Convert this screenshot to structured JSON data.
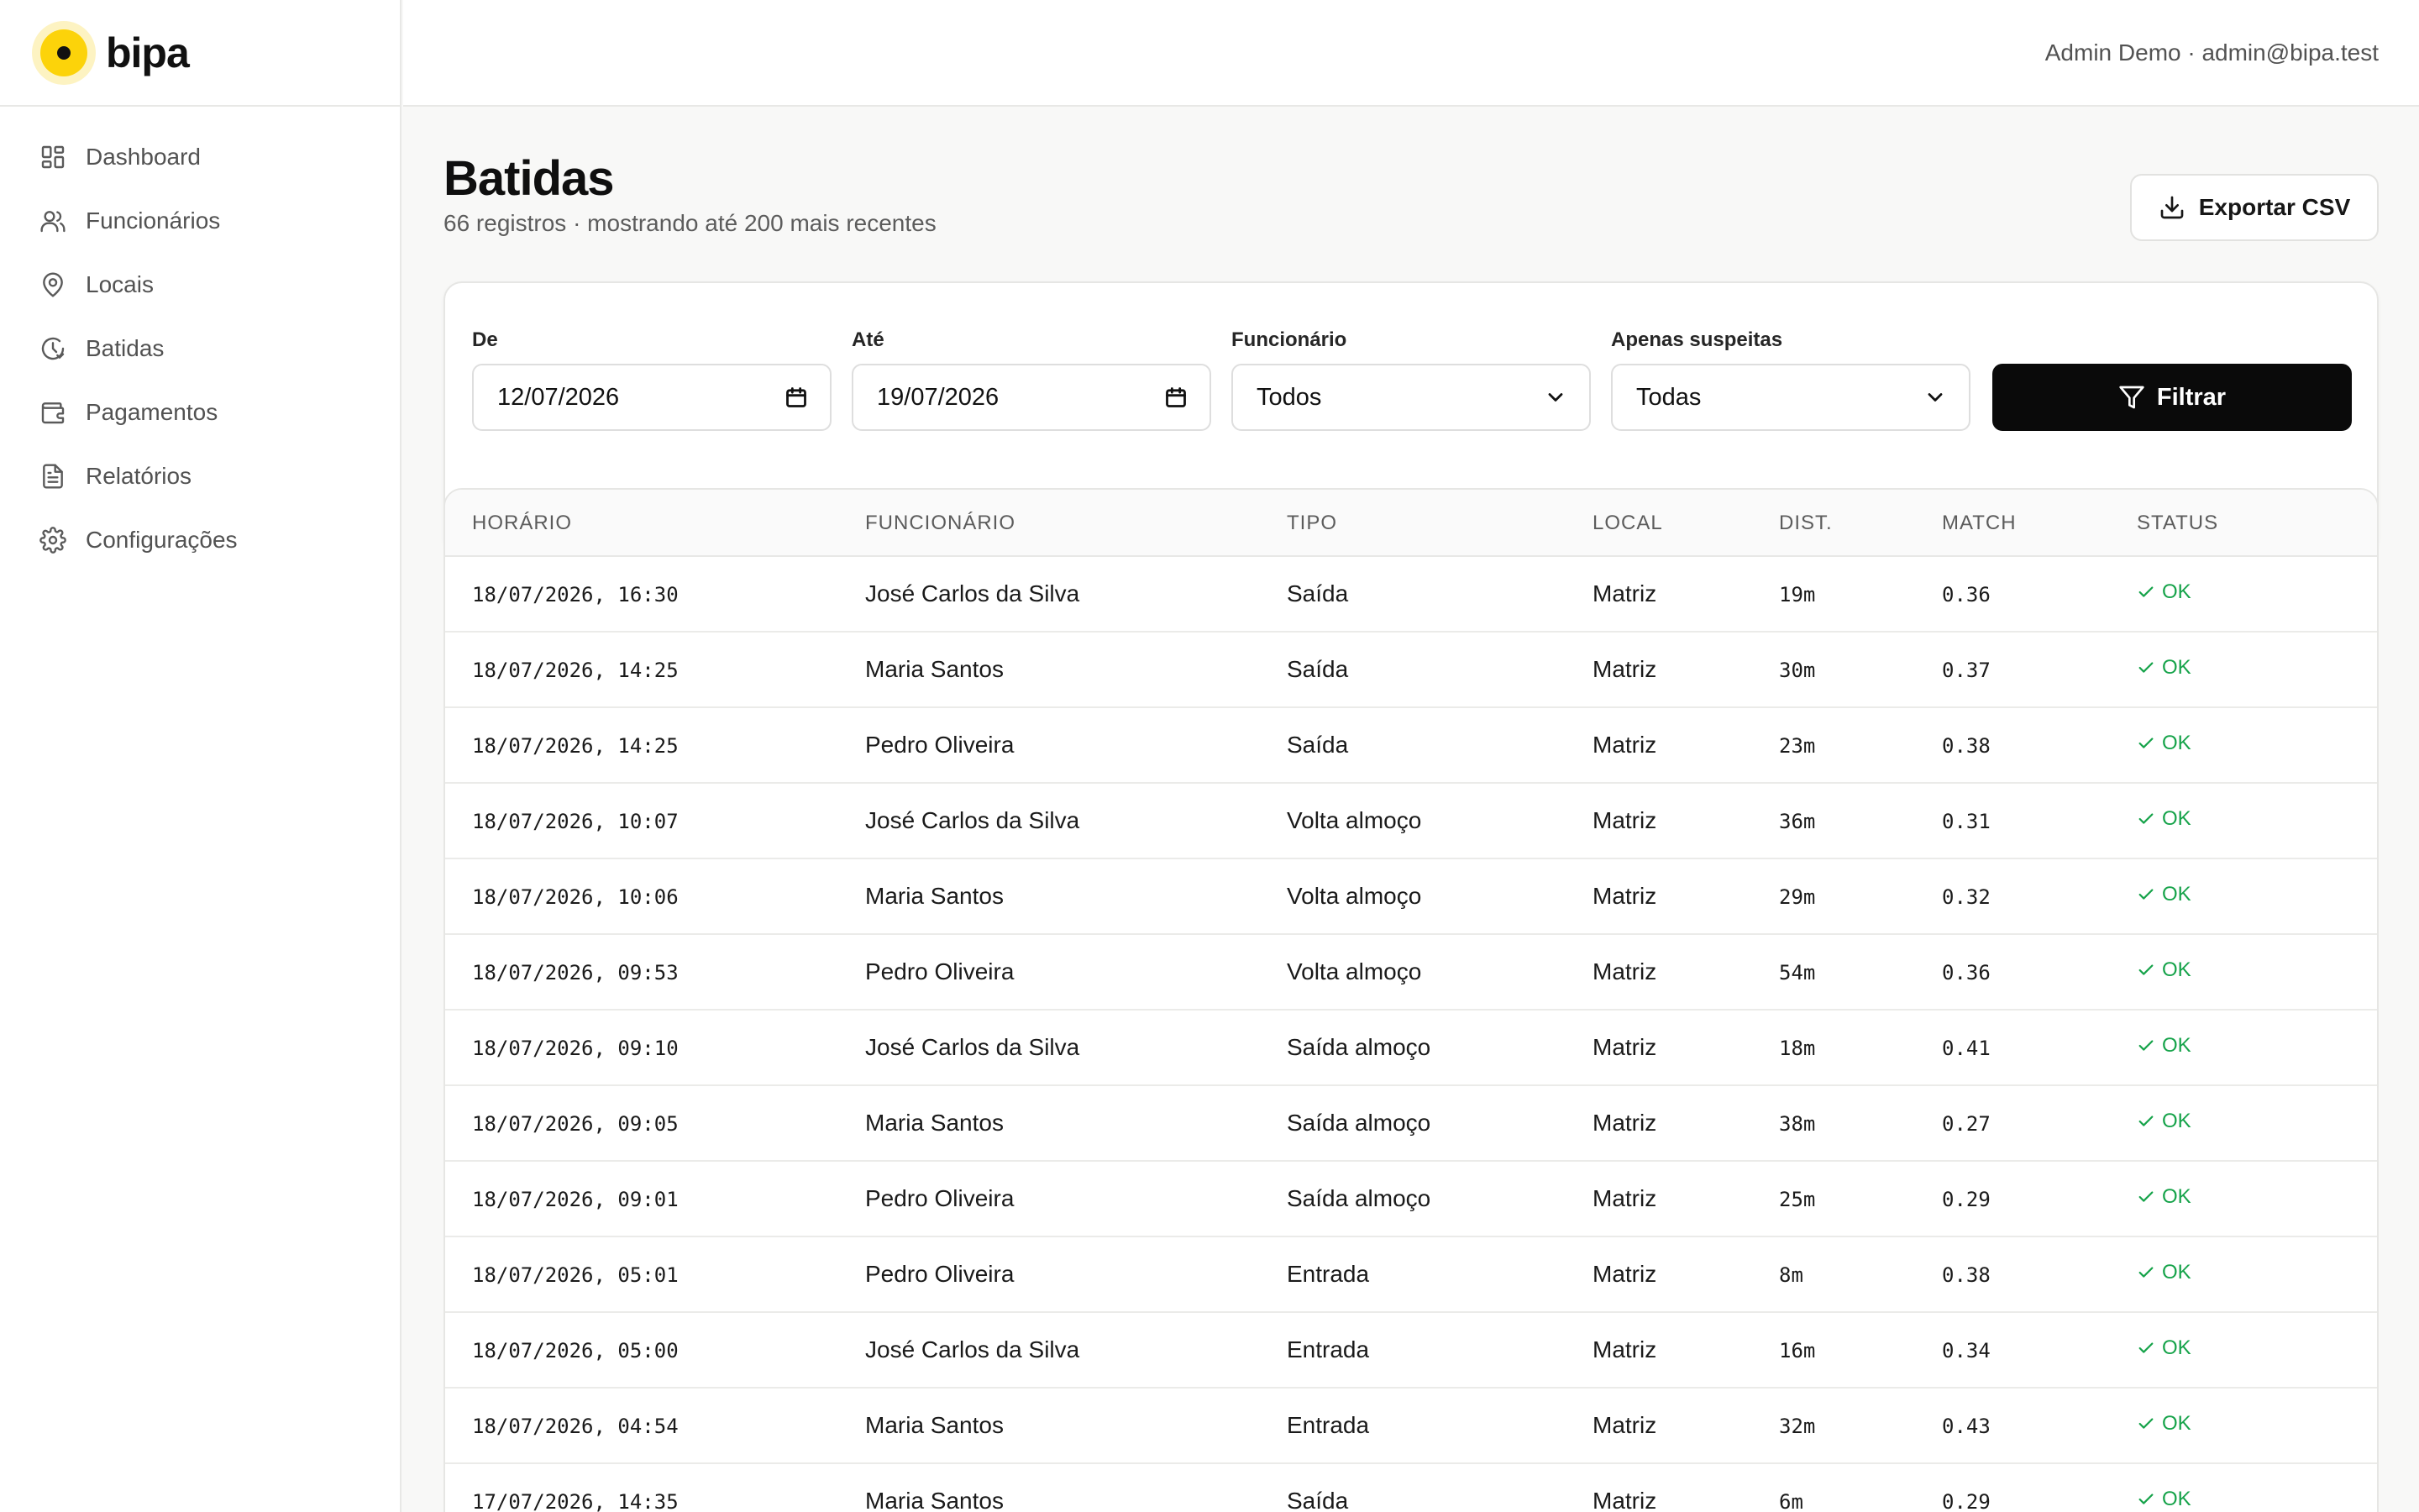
{
  "brand": {
    "name": "bipa"
  },
  "header": {
    "user": "Admin Demo · admin@bipa.test"
  },
  "sidebar": {
    "items": [
      {
        "label": "Dashboard",
        "icon": "dashboard-icon"
      },
      {
        "label": "Funcionários",
        "icon": "users-icon"
      },
      {
        "label": "Locais",
        "icon": "map-pin-icon"
      },
      {
        "label": "Batidas",
        "icon": "clock-history-icon"
      },
      {
        "label": "Pagamentos",
        "icon": "wallet-icon"
      },
      {
        "label": "Relatórios",
        "icon": "file-text-icon"
      },
      {
        "label": "Configurações",
        "icon": "gear-icon"
      }
    ]
  },
  "page": {
    "title": "Batidas",
    "subtitle": "66 registros · mostrando até 200 mais recentes",
    "export_label": "Exportar CSV"
  },
  "filters": {
    "from": {
      "label": "De",
      "value": "12/07/2026"
    },
    "to": {
      "label": "Até",
      "value": "19/07/2026"
    },
    "employee": {
      "label": "Funcionário",
      "value": "Todos"
    },
    "suspicious": {
      "label": "Apenas suspeitas",
      "value": "Todas"
    },
    "submit_label": "Filtrar"
  },
  "table": {
    "columns": [
      "HORÁRIO",
      "FUNCIONÁRIO",
      "TIPO",
      "LOCAL",
      "DIST.",
      "MATCH",
      "STATUS"
    ],
    "rows": [
      {
        "time": "18/07/2026, 16:30",
        "employee": "José Carlos da Silva",
        "type": "Saída",
        "location": "Matriz",
        "dist": "19m",
        "match": "0.36",
        "status": "OK"
      },
      {
        "time": "18/07/2026, 14:25",
        "employee": "Maria Santos",
        "type": "Saída",
        "location": "Matriz",
        "dist": "30m",
        "match": "0.37",
        "status": "OK"
      },
      {
        "time": "18/07/2026, 14:25",
        "employee": "Pedro Oliveira",
        "type": "Saída",
        "location": "Matriz",
        "dist": "23m",
        "match": "0.38",
        "status": "OK"
      },
      {
        "time": "18/07/2026, 10:07",
        "employee": "José Carlos da Silva",
        "type": "Volta almoço",
        "location": "Matriz",
        "dist": "36m",
        "match": "0.31",
        "status": "OK"
      },
      {
        "time": "18/07/2026, 10:06",
        "employee": "Maria Santos",
        "type": "Volta almoço",
        "location": "Matriz",
        "dist": "29m",
        "match": "0.32",
        "status": "OK"
      },
      {
        "time": "18/07/2026, 09:53",
        "employee": "Pedro Oliveira",
        "type": "Volta almoço",
        "location": "Matriz",
        "dist": "54m",
        "match": "0.36",
        "status": "OK"
      },
      {
        "time": "18/07/2026, 09:10",
        "employee": "José Carlos da Silva",
        "type": "Saída almoço",
        "location": "Matriz",
        "dist": "18m",
        "match": "0.41",
        "status": "OK"
      },
      {
        "time": "18/07/2026, 09:05",
        "employee": "Maria Santos",
        "type": "Saída almoço",
        "location": "Matriz",
        "dist": "38m",
        "match": "0.27",
        "status": "OK"
      },
      {
        "time": "18/07/2026, 09:01",
        "employee": "Pedro Oliveira",
        "type": "Saída almoço",
        "location": "Matriz",
        "dist": "25m",
        "match": "0.29",
        "status": "OK"
      },
      {
        "time": "18/07/2026, 05:01",
        "employee": "Pedro Oliveira",
        "type": "Entrada",
        "location": "Matriz",
        "dist": "8m",
        "match": "0.38",
        "status": "OK"
      },
      {
        "time": "18/07/2026, 05:00",
        "employee": "José Carlos da Silva",
        "type": "Entrada",
        "location": "Matriz",
        "dist": "16m",
        "match": "0.34",
        "status": "OK"
      },
      {
        "time": "18/07/2026, 04:54",
        "employee": "Maria Santos",
        "type": "Entrada",
        "location": "Matriz",
        "dist": "32m",
        "match": "0.43",
        "status": "OK"
      },
      {
        "time": "17/07/2026, 14:35",
        "employee": "Maria Santos",
        "type": "Saída",
        "location": "Matriz",
        "dist": "6m",
        "match": "0.29",
        "status": "OK"
      }
    ]
  }
}
